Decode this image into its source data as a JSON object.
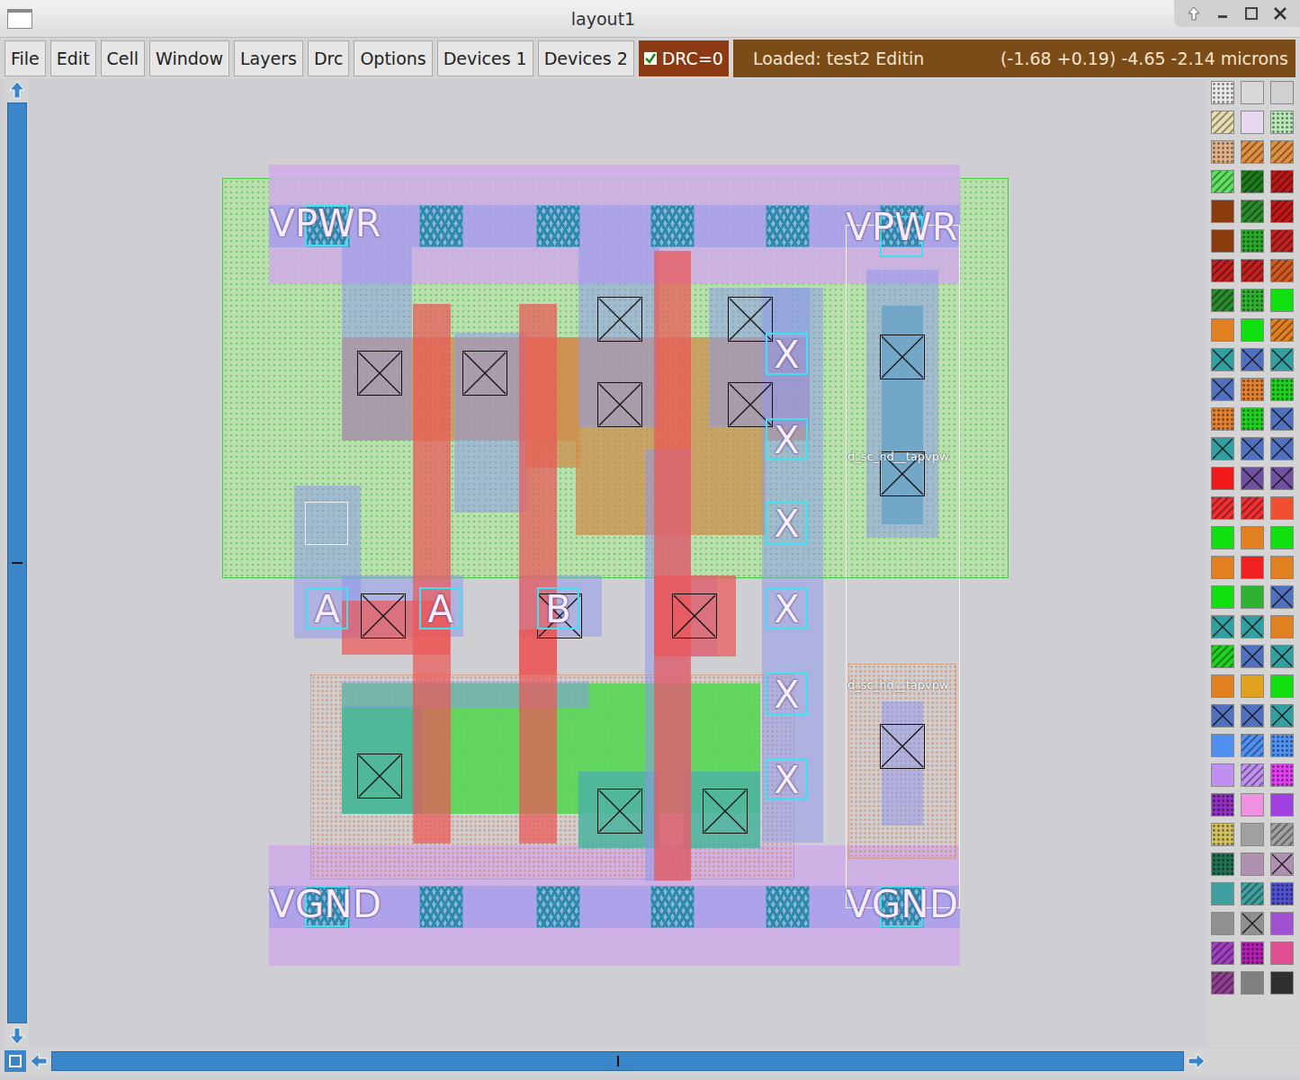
{
  "window": {
    "title": "layout1"
  },
  "menu": [
    "File",
    "Edit",
    "Cell",
    "Window",
    "Layers",
    "Drc",
    "Options",
    "Devices 1",
    "Devices 2"
  ],
  "drc": {
    "label": "DRC=0",
    "checked": true
  },
  "status": {
    "loaded": "Loaded: test2 Editin",
    "coords": "(-1.68 +0.19) -4.65 -2.14 microns"
  },
  "labels": [
    "VPWR",
    "VGND",
    "VPWR",
    "VGND",
    "A",
    "A",
    "B",
    "X",
    "X",
    "X",
    "X",
    "X",
    "X"
  ],
  "cells": [
    "d_sc_hd__tapvpw",
    "d_sc_hd__tapvpw"
  ]
}
